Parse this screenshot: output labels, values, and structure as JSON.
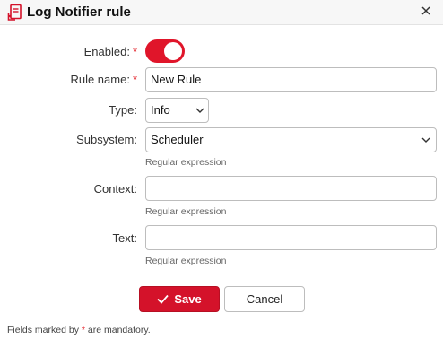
{
  "dialog": {
    "title": "Log Notifier rule",
    "title_icon": "log-notifier-icon",
    "close_icon": "close-icon"
  },
  "form": {
    "required_marker": "*",
    "enabled": {
      "label": "Enabled:",
      "value": true
    },
    "rule_name": {
      "label": "Rule name:",
      "value": "New Rule"
    },
    "type": {
      "label": "Type:",
      "value": "Info"
    },
    "subsystem": {
      "label": "Subsystem:",
      "value": "Scheduler",
      "hint": "Regular expression"
    },
    "context": {
      "label": "Context:",
      "value": "",
      "hint": "Regular expression"
    },
    "text": {
      "label": "Text:",
      "value": "",
      "hint": "Regular expression"
    }
  },
  "buttons": {
    "save": "Save",
    "cancel": "Cancel"
  },
  "footnote": {
    "before": "Fields marked by ",
    "marker": "*",
    "after": " are mandatory."
  },
  "colors": {
    "accent": "#d4122a",
    "required": "#e2171f"
  }
}
